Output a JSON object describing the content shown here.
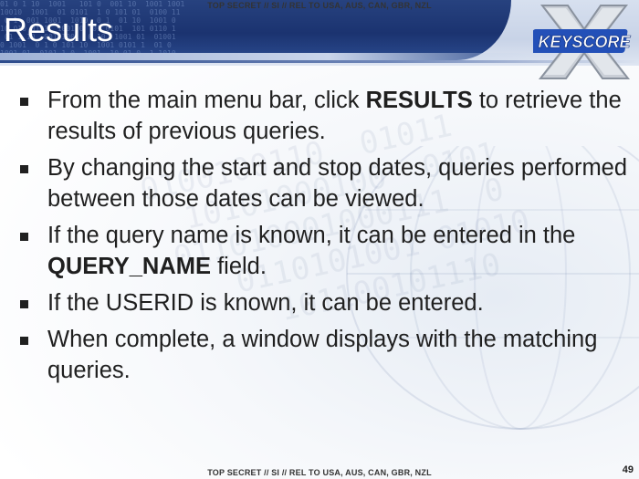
{
  "classification": {
    "top": "TOP SECRET // SI // REL TO USA, AUS, CAN, GBR, NZL",
    "bottom": "TOP SECRET // SI // REL TO USA, AUS, CAN, GBR, NZL"
  },
  "slide": {
    "title": "Results",
    "logo_text": "KEYSCORE",
    "page_number": "49"
  },
  "bullets": [
    {
      "parts": [
        {
          "text": "From the main menu bar, click "
        },
        {
          "text": "RESULTS",
          "bold": true
        },
        {
          "text": " to retrieve the results of previous queries."
        }
      ]
    },
    {
      "parts": [
        {
          "text": "By changing the start and stop dates, queries performed between those dates can be viewed."
        }
      ]
    },
    {
      "parts": [
        {
          "text": "If the query name is known, it can be entered in the "
        },
        {
          "text": "QUERY_NAME",
          "bold": true
        },
        {
          "text": " field."
        }
      ]
    },
    {
      "parts": [
        {
          "text": "If the USERID is known, it can be entered."
        }
      ]
    },
    {
      "parts": [
        {
          "text": "When complete, a window displays with the matching queries."
        }
      ]
    }
  ],
  "colors": {
    "banner_dark": "#1b3370",
    "title_text": "#ffffff",
    "body_text": "#1f1f1f",
    "logo_blue": "#2350b8"
  }
}
